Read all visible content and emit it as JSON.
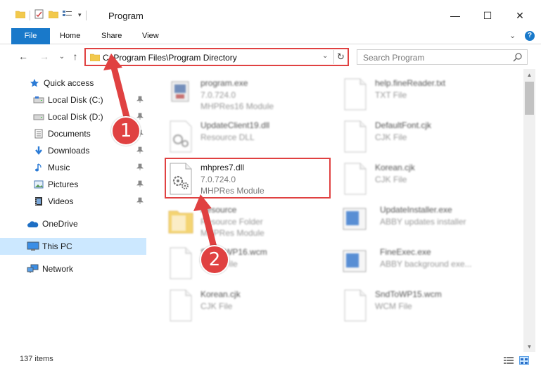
{
  "window": {
    "title": "Program",
    "minimize_glyph": "—",
    "maximize_glyph": "☐",
    "close_glyph": "✕",
    "help_glyph": "?",
    "expand_glyph": "⌄"
  },
  "ribbon": {
    "tabs": [
      {
        "label": "File",
        "active": true
      },
      {
        "label": "Home"
      },
      {
        "label": "Share"
      },
      {
        "label": "View"
      }
    ]
  },
  "nav": {
    "back_glyph": "←",
    "forward_glyph": "→",
    "recent_glyph": "⌄",
    "up_glyph": "↑"
  },
  "address": {
    "path": "C:\\Program Files\\Program Directory",
    "dropdown_glyph": "⌄",
    "refresh_glyph": "↻"
  },
  "search": {
    "placeholder": "Search Program"
  },
  "sidebar": {
    "items": [
      {
        "label": "Quick access",
        "icon": "star-icon"
      },
      {
        "label": "Local Disk (C:)",
        "icon": "drive-icon",
        "pinned": true
      },
      {
        "label": "Local Disk (D:)",
        "icon": "drive-icon",
        "pinned": true
      },
      {
        "label": "Documents",
        "icon": "documents-icon",
        "pinned": true
      },
      {
        "label": "Downloads",
        "icon": "download-icon",
        "pinned": true
      },
      {
        "label": "Music",
        "icon": "music-icon",
        "pinned": true
      },
      {
        "label": "Pictures",
        "icon": "pictures-icon",
        "pinned": true
      },
      {
        "label": "Videos",
        "icon": "videos-icon",
        "pinned": true
      },
      {
        "label": "OneDrive",
        "icon": "cloud-icon"
      },
      {
        "label": "This PC",
        "icon": "computer-icon",
        "selected": true
      },
      {
        "label": "Network",
        "icon": "network-icon"
      }
    ],
    "pin_glyph": "📌"
  },
  "files": [
    {
      "name": "program.exe",
      "line2": "7.0.724.0",
      "line3": "MHPRes16 Module",
      "icon": "exe-icon",
      "blurred": true
    },
    {
      "name": "help.fineReader.txt",
      "line2": "TXT File",
      "line3": "",
      "icon": "file-icon",
      "blurred": true
    },
    {
      "name": "UpdateClient19.dll",
      "line2": "Resource DLL",
      "line3": "",
      "icon": "dll-icon",
      "blurred": true
    },
    {
      "name": "DefaultFont.cjk",
      "line2": "CJK File",
      "line3": "",
      "icon": "file-icon",
      "blurred": true
    },
    {
      "name": "mhpres7.dll",
      "line2": "7.0.724.0",
      "line3": "MHPRes Module",
      "icon": "dll-icon",
      "blurred": false
    },
    {
      "name": "Korean.cjk",
      "line2": "CJK File",
      "line3": "",
      "icon": "file-icon",
      "blurred": true
    },
    {
      "name": "Resource",
      "line2": "Resource Folder",
      "line3": "MHPRes Module",
      "icon": "folder-icon",
      "blurred": true
    },
    {
      "name": "UpdateInstaller.exe",
      "line2": "ABBY updates installer",
      "line3": "",
      "icon": "installer-icon",
      "blurred": true
    },
    {
      "name": "SndToWP16.wcm",
      "line2": "WCM File",
      "line3": "",
      "icon": "file-icon",
      "blurred": true
    },
    {
      "name": "FineExec.exe",
      "line2": "ABBY background exe...",
      "line3": "",
      "icon": "installer-icon",
      "blurred": true
    },
    {
      "name": "Korean.cjk",
      "line2": "CJK File",
      "line3": "",
      "icon": "file-icon",
      "blurred": true
    },
    {
      "name": "SndToWP15.wcm",
      "line2": "WCM File",
      "line3": "",
      "icon": "file-icon",
      "blurred": true
    }
  ],
  "status": {
    "item_count": "137 items"
  },
  "callouts": [
    {
      "label": "1"
    },
    {
      "label": "2"
    }
  ],
  "colors": {
    "accent": "#1979ca",
    "highlight": "#e04141",
    "selected_bg": "#cce8ff"
  }
}
